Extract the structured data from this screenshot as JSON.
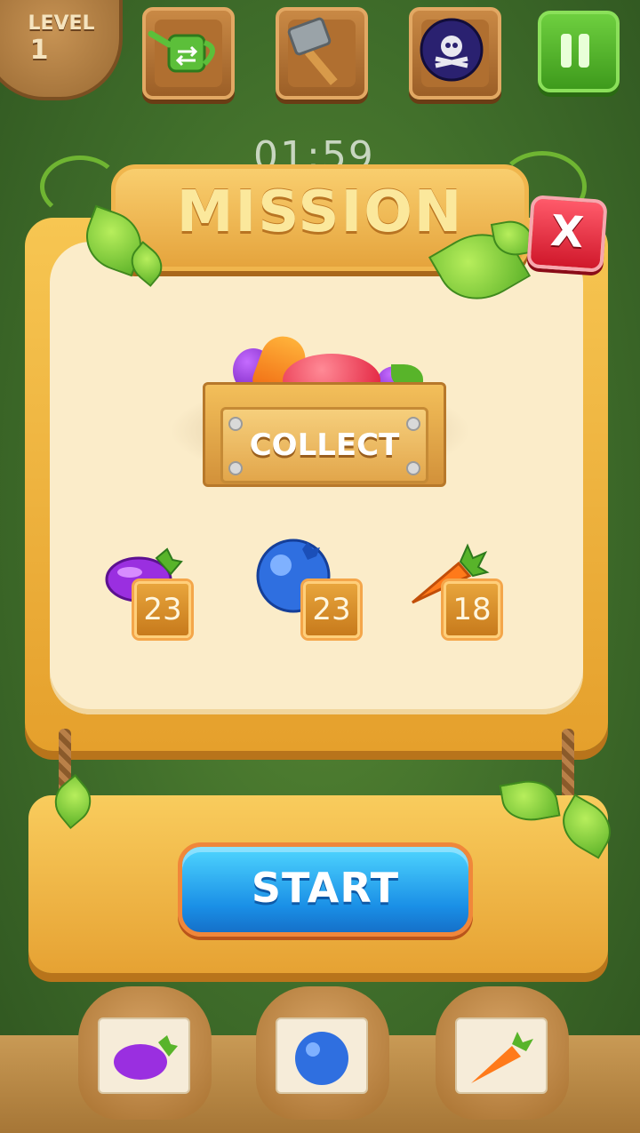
{
  "hud": {
    "level_label": "LEVEL",
    "level_number": "1",
    "timer": "01:59",
    "tools": [
      "watering-can-icon",
      "hammer-icon",
      "skull-bomb-icon"
    ]
  },
  "dialog": {
    "title": "MISSION",
    "close_label": "X",
    "crate_label": "COLLECT",
    "goals": [
      {
        "item": "eggplant",
        "count": "23"
      },
      {
        "item": "blueberry",
        "count": "23"
      },
      {
        "item": "carrot",
        "count": "18"
      }
    ],
    "start_label": "START"
  },
  "colors": {
    "start_button": "#1a8fe6",
    "close_button": "#d0182b",
    "pause_button": "#3e9a1c"
  }
}
